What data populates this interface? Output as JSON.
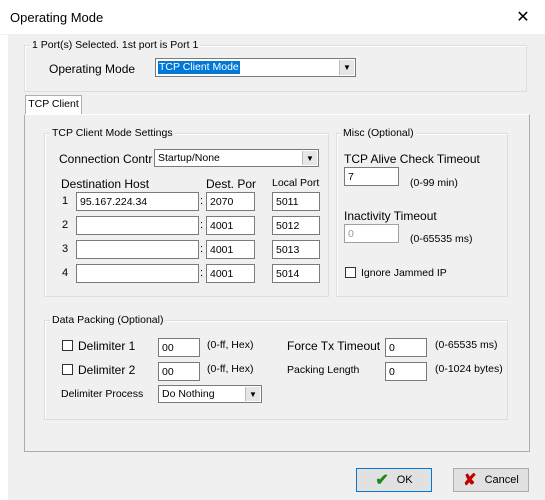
{
  "window": {
    "title": "Operating Mode"
  },
  "ports": {
    "group_label": "1 Port(s) Selected. 1st port is Port 1",
    "operating_mode_label": "Operating Mode",
    "operating_mode_value": "TCP Client Mode"
  },
  "tab": {
    "label": "TCP Client"
  },
  "client_settings": {
    "group_label": "TCP Client Mode Settings",
    "connection_control_label": "Connection Contr",
    "connection_control_value": "Startup/None",
    "dest_host_header": "Destination Host",
    "dest_port_header": "Dest. Por",
    "local_port_header": "Local Port",
    "rows": [
      {
        "num": "1",
        "host": "95.167.224.34",
        "dest_port": "2070",
        "local_port": "5011"
      },
      {
        "num": "2",
        "host": "",
        "dest_port": "4001",
        "local_port": "5012"
      },
      {
        "num": "3",
        "host": "",
        "dest_port": "4001",
        "local_port": "5013"
      },
      {
        "num": "4",
        "host": "",
        "dest_port": "4001",
        "local_port": "5014"
      }
    ],
    "separator": ":"
  },
  "misc": {
    "group_label": "Misc (Optional)",
    "alive_label": "TCP Alive Check Timeout",
    "alive_value": "7",
    "alive_range": "(0-99 min)",
    "inactivity_label": "Inactivity Timeout",
    "inactivity_value": "0",
    "inactivity_range": "(0-65535 ms)",
    "ignore_jammed_label": "Ignore Jammed IP"
  },
  "packing": {
    "group_label": "Data Packing (Optional)",
    "delim1_label": "Delimiter 1",
    "delim1_value": "00",
    "delim1_range": "(0-ff, Hex)",
    "delim2_label": "Delimiter 2",
    "delim2_value": "00",
    "delim2_range": "(0-ff, Hex)",
    "delim_process_label": "Delimiter Process",
    "delim_process_value": "Do Nothing",
    "force_tx_label": "Force Tx Timeout",
    "force_tx_value": "0",
    "force_tx_range": "(0-65535 ms)",
    "packing_len_label": "Packing Length",
    "packing_len_value": "0",
    "packing_len_range": "(0-1024 bytes)"
  },
  "buttons": {
    "ok": "OK",
    "cancel": "Cancel"
  },
  "colors": {
    "selection": "#0078d7",
    "ok_icon": "#1a8a1a",
    "cancel_icon": "#c00000"
  }
}
